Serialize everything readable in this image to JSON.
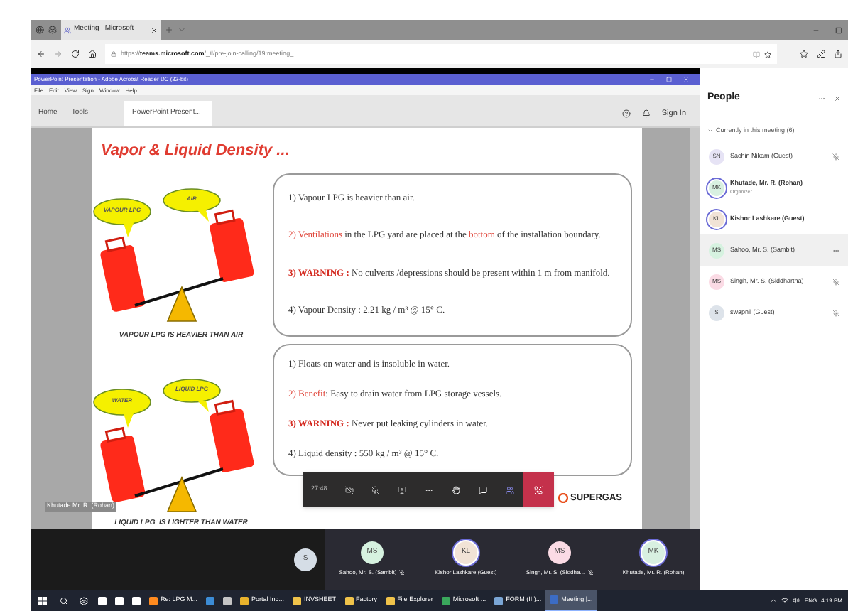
{
  "browser": {
    "tab_title": "Meeting | Microsoft",
    "url_scheme": "https://",
    "url_host": "teams.microsoft.com",
    "url_path": "/_#/pre-join-calling/19:meeting_"
  },
  "reader": {
    "title": "PowerPoint Presentation - Adobe Acrobat Reader DC (32-bit)",
    "menu": [
      "File",
      "Edit",
      "View",
      "Sign",
      "Window",
      "Help"
    ],
    "nav": [
      "Home",
      "Tools"
    ],
    "document_tab": "PowerPoint Present...",
    "sign_in": "Sign In"
  },
  "slide": {
    "title": "Vapor & Liquid Density ...",
    "sections": [
      {
        "bubbles": [
          "VAPOUR LPG",
          "AIR"
        ],
        "caption": "VAPOUR LPG IS HEAVIER THAN AIR",
        "points": [
          {
            "parts": [
              {
                "text": "1) Vapour LPG is heavier than air.",
                "kind": "plain"
              }
            ]
          },
          {
            "parts": [
              {
                "text": "2) Ventilations",
                "kind": "highlight"
              },
              {
                "text": " in the LPG yard are placed at the ",
                "kind": "plain"
              },
              {
                "text": "bottom",
                "kind": "highlight"
              },
              {
                "text": " of the installation boundary.",
                "kind": "plain"
              }
            ]
          },
          {
            "parts": [
              {
                "text": "3) WARNING :",
                "kind": "warning"
              },
              {
                "text": " No culverts /depressions should be present within 1 m from manifold.",
                "kind": "plain"
              }
            ]
          },
          {
            "parts": [
              {
                "text": "4) Vapour Density : 2.21 kg / m³ @ 15° C.",
                "kind": "plain"
              }
            ]
          }
        ]
      },
      {
        "bubbles": [
          "WATER",
          "LIQUID LPG"
        ],
        "caption": "LIQUID LPG  IS LIGHTER THAN WATER",
        "points": [
          {
            "parts": [
              {
                "text": "1) Floats on water and is insoluble in water.",
                "kind": "plain"
              }
            ]
          },
          {
            "parts": [
              {
                "text": "2) Benefit",
                "kind": "highlight"
              },
              {
                "text": ": Easy to drain water from LPG storage vessels.",
                "kind": "plain"
              }
            ]
          },
          {
            "parts": [
              {
                "text": "3) WARNING :",
                "kind": "warning"
              },
              {
                "text": " Never put leaking cylinders  in water.",
                "kind": "plain"
              }
            ]
          },
          {
            "parts": [
              {
                "text": "4) Liquid density : 550 kg / m³ @ 15° C.",
                "kind": "plain"
              }
            ]
          }
        ]
      }
    ],
    "logo": "SUPERGAS",
    "presenter_label": "Khutade Mr. R. (Rohan)"
  },
  "meeting_controls": {
    "timer": "27:48"
  },
  "people_panel": {
    "title": "People",
    "section": "Currently in this meeting (6)",
    "expanded": true,
    "participants": [
      {
        "initials": "SN",
        "name": "Sachin Nikam (Guest)",
        "color": "#e6e3f5",
        "speaking": false,
        "muted": true,
        "selected": false
      },
      {
        "initials": "MK",
        "name": "Khutade, Mr. R. (Rohan)",
        "role": "Organizer",
        "color": "#d8f0e1",
        "speaking": true,
        "muted": false,
        "selected": false
      },
      {
        "initials": "KL",
        "name": "Kishor Lashkare (Guest)",
        "color": "#f1e3d6",
        "speaking": true,
        "muted": false,
        "selected": false
      },
      {
        "initials": "MS",
        "name": "Sahoo, Mr. S. (Sambit)",
        "color": "#d6f2e0",
        "speaking": false,
        "selected": true
      },
      {
        "initials": "MS",
        "name": "Singh, Mr. S. (Siddhartha)",
        "color": "#fbdbe5",
        "speaking": false,
        "muted": true,
        "selected": false
      },
      {
        "initials": "S",
        "name": "swapnil (Guest)",
        "color": "#dde3ea",
        "speaking": false,
        "muted": true,
        "selected": false
      }
    ]
  },
  "video_strip": [
    {
      "initials": "S",
      "color": "#d5dde6",
      "speaking": false,
      "muted": false
    },
    {
      "initials": "MS",
      "name": "Sahoo, Mr. S. (Sambit)",
      "color": "#d6f2e0",
      "speaking": false,
      "muted": true
    },
    {
      "initials": "KL",
      "name": "Kishor Lashkare (Guest)",
      "color": "#f1e3d6",
      "speaking": true,
      "muted": false
    },
    {
      "initials": "MS",
      "name": "Singh, Mr. S. (Siddha...",
      "color": "#fbdbe5",
      "speaking": false,
      "muted": true
    },
    {
      "initials": "MK",
      "name": "Khutade, Mr. R. (Rohan)",
      "color": "#d8f0e1",
      "speaking": true,
      "muted": false
    }
  ],
  "taskbar": {
    "items": [
      {
        "kind": "icon",
        "active": false
      },
      {
        "kind": "icon",
        "active": false
      },
      {
        "kind": "icon",
        "active": false
      },
      {
        "kind": "app",
        "label": "Re: LPG M...",
        "active": false
      },
      {
        "kind": "icon",
        "active": false
      },
      {
        "kind": "icon",
        "active": false
      },
      {
        "kind": "app",
        "label": "Portal Ind...",
        "active": false
      },
      {
        "kind": "app",
        "label": "INVSHEET",
        "active": false
      },
      {
        "kind": "app",
        "label": "Factory",
        "active": false
      },
      {
        "kind": "app",
        "label": "File Explorer",
        "active": false
      },
      {
        "kind": "app",
        "label": "Microsoft ...",
        "active": false
      },
      {
        "kind": "app",
        "label": "FORM (III)...",
        "active": false
      },
      {
        "kind": "app",
        "label": "Meeting |...",
        "active": true
      }
    ],
    "language": "ENG",
    "time": "4:19 PM"
  }
}
